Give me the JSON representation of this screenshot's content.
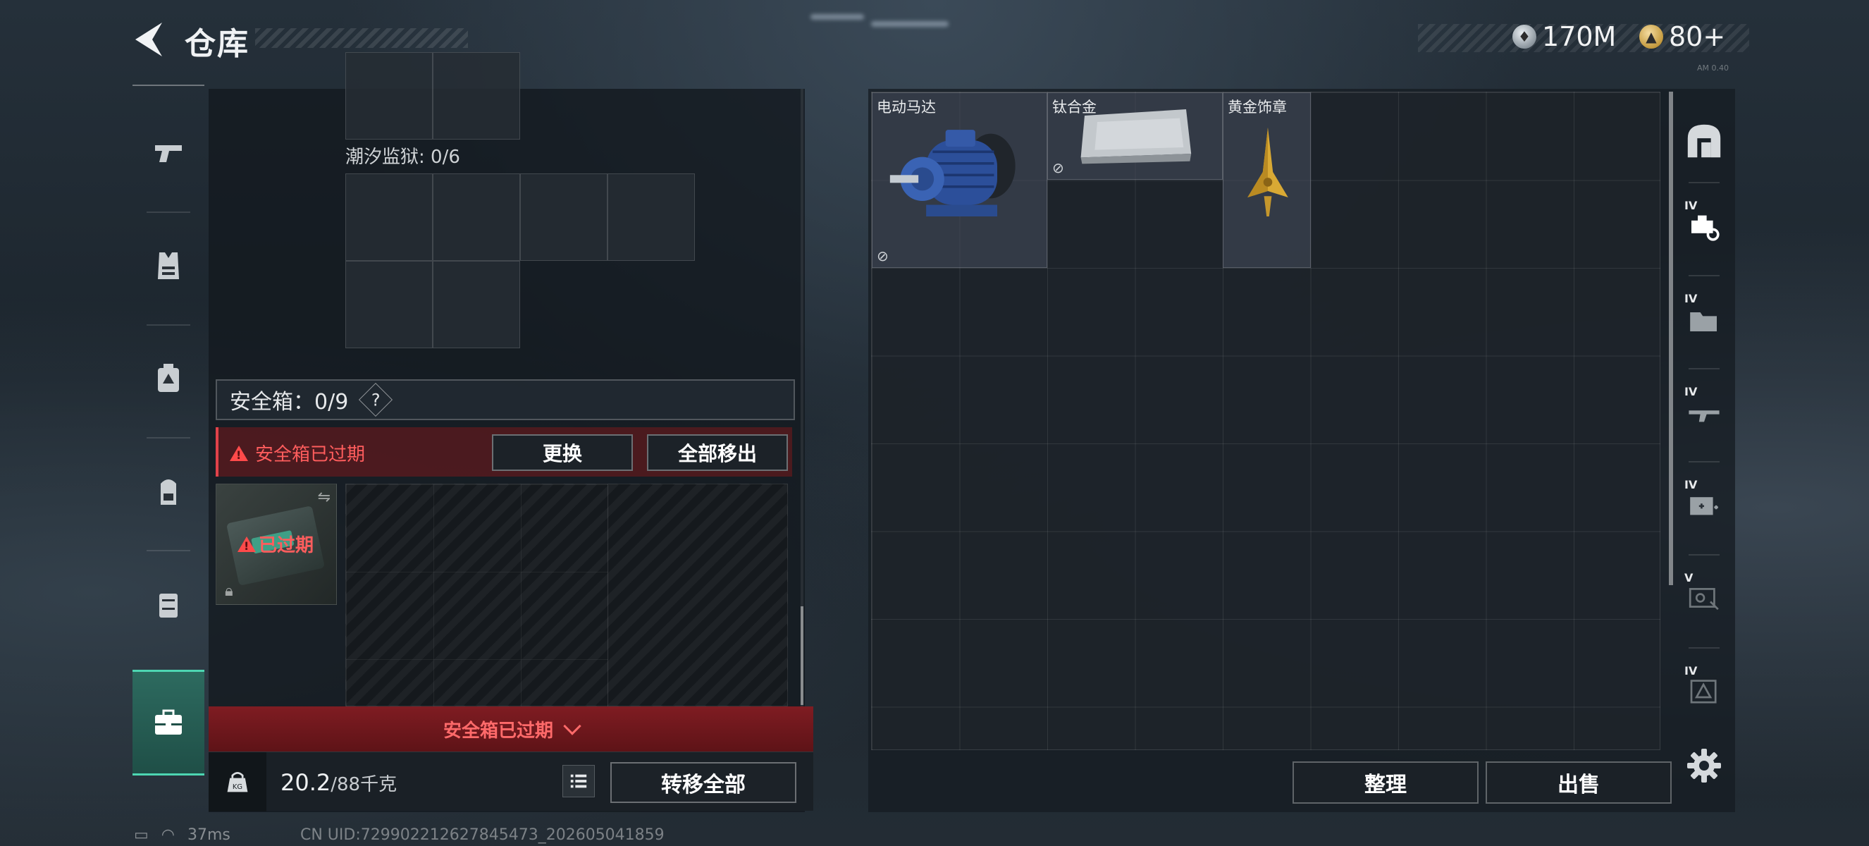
{
  "header": {
    "title": "仓库",
    "currency_silver": "170M",
    "currency_gold": "80+",
    "build_tag": "AM 0.40"
  },
  "sidebar": {
    "items": [
      {
        "icon": "pistol-icon"
      },
      {
        "icon": "vest-icon"
      },
      {
        "icon": "rig-icon"
      },
      {
        "icon": "backpack-icon"
      },
      {
        "icon": "pouch-icon"
      },
      {
        "icon": "safebox-icon",
        "active": true
      }
    ]
  },
  "left": {
    "container_label": "潮汐监狱: 0/6",
    "safe_label": "安全箱：0/9",
    "safe_help": "?",
    "expired_notice": "安全箱已过期",
    "replace_button": "更换",
    "remove_all_button": "全部移出",
    "case_status": "已过期",
    "expired_footer": "安全箱已过期",
    "weight_current": "20.2",
    "weight_max": "/88千克",
    "transfer_all_button": "转移全部"
  },
  "stash": {
    "items": [
      {
        "name": "电动马达"
      },
      {
        "name": "钛合金"
      },
      {
        "name": "黄金饰章"
      }
    ]
  },
  "tools": {
    "tiers": [
      "IV",
      "IV",
      "IV",
      "IV",
      "V",
      "IV"
    ]
  },
  "actions": {
    "sort_button": "整理",
    "sell_button": "出售"
  },
  "status": {
    "ping": "37ms",
    "uid": "CN UID:7299022126278454​73_202605041859"
  },
  "colors": {
    "accent_teal": "#4dd6b2",
    "alert_red": "#ff5d5d"
  }
}
